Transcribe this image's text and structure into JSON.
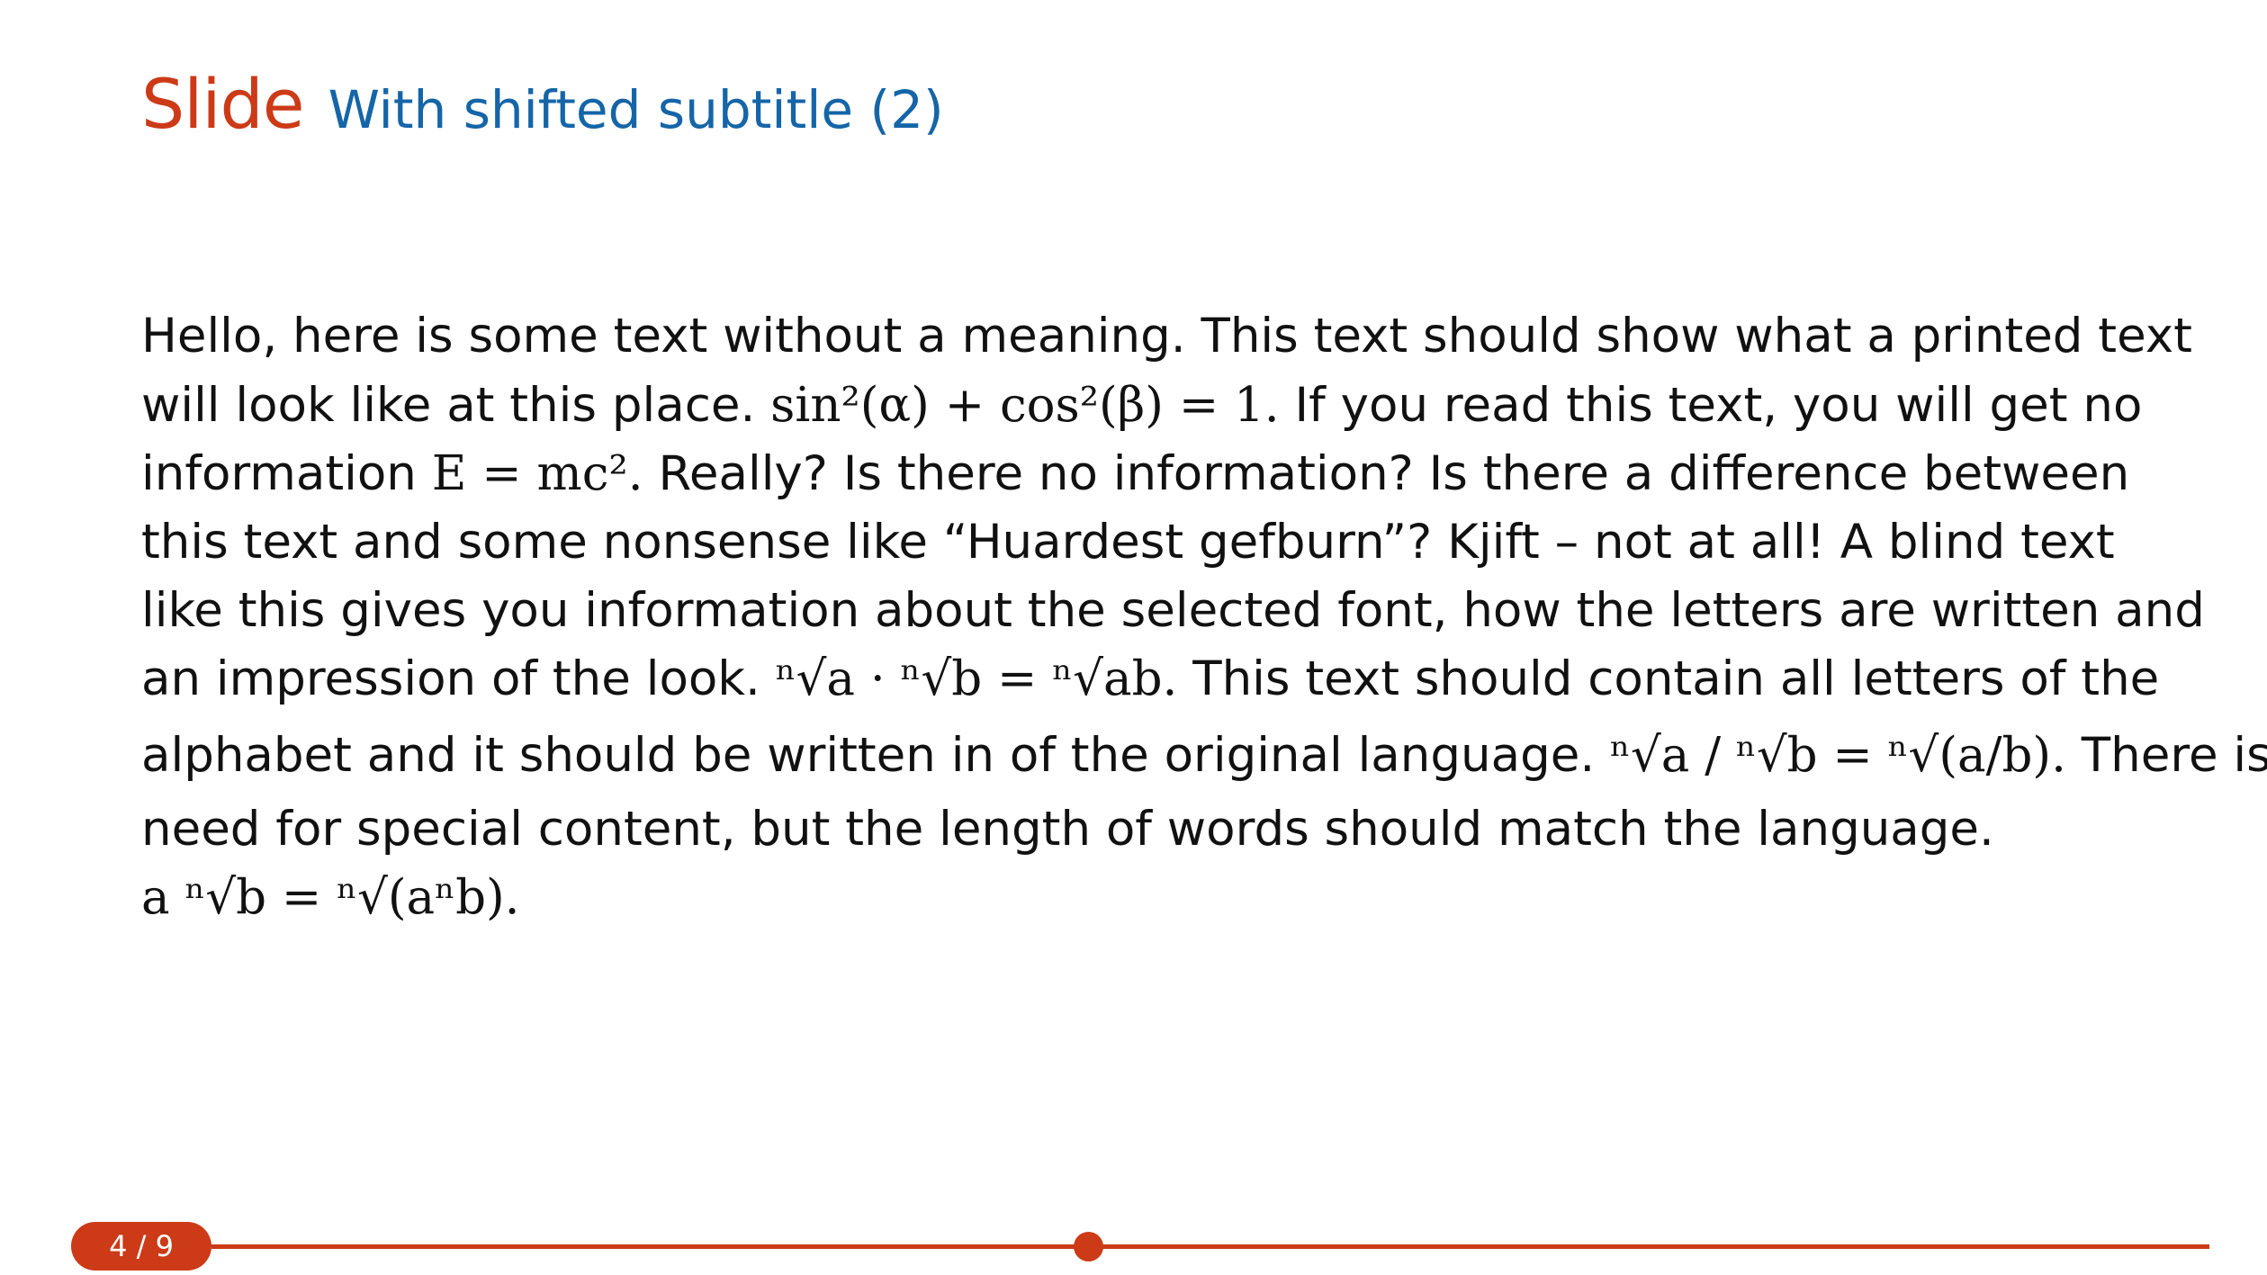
{
  "slide": {
    "title": "Slide",
    "subtitle": "With shifted subtitle (2)"
  },
  "body": {
    "line1": "Hello, here is some text without a meaning.  This text should show what a printed text",
    "line2_text_a": "will look like at this place.",
    "line2_math": "sin²(α) + cos²(β) = 1.",
    "line2_text_b": "If you read this text, you will get no",
    "line3_text_a": "information",
    "line3_math": "E = mc².",
    "line3_text_b": "Really?  Is there no information?  Is there a difference between",
    "line4": "this text and some nonsense like “Huardest gefburn”?  Kjift – not at all!  A blind text",
    "line5": "like this gives you information about the selected font, how the letters are written and",
    "line6_text_a": "an impression of the look.",
    "line6_math": "ⁿ√a · ⁿ√b = ⁿ√ab.",
    "line6_text_b": "This text should contain all letters of the",
    "line7_text_a": "alphabet and it should be written in of the original language.",
    "line7_math": "ⁿ√a / ⁿ√b = ⁿ√(a/b).",
    "line7_text_b": "There is no",
    "line8": "need for special content, but the length of words should match the language.",
    "line9_math": "a ⁿ√b = ⁿ√(aⁿb)."
  },
  "footer": {
    "page_indicator": "4 / 9"
  },
  "colors": {
    "accent": "#cc3a17",
    "subtitle": "#1565a8",
    "text": "#111111"
  }
}
